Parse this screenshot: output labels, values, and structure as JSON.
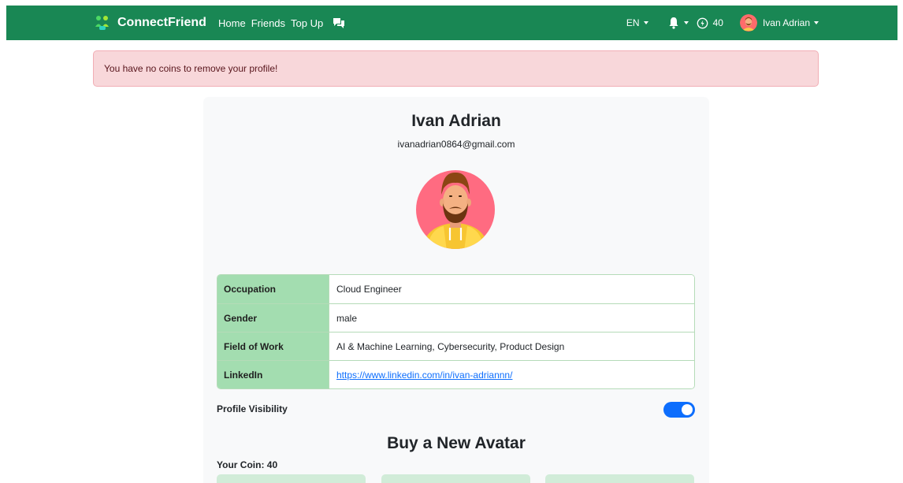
{
  "navbar": {
    "brand": "ConnectFriend",
    "links": [
      "Home",
      "Friends",
      "Top Up"
    ],
    "chat_icon": "chat-bubbles-icon",
    "language": "EN",
    "notification_icon": "bell-icon",
    "coin_icon": "coin-icon",
    "coins": "40",
    "user_name": "Ivan Adrian"
  },
  "alert": {
    "message": "You have no coins to remove your profile!"
  },
  "profile": {
    "name": "Ivan Adrian",
    "email": "ivanadrian0864@gmail.com",
    "avatar_icon": "bearded-man-avatar-icon",
    "details": [
      {
        "label": "Occupation",
        "value": "Cloud Engineer"
      },
      {
        "label": "Gender",
        "value": "male"
      },
      {
        "label": "Field of Work",
        "value": "AI & Machine Learning, Cybersecurity, Product Design"
      },
      {
        "label": "LinkedIn",
        "value": "https://www.linkedin.com/in/ivan-adriannn/"
      }
    ],
    "visibility_label": "Profile Visibility",
    "visibility_on": true
  },
  "shop": {
    "title": "Buy a New Avatar",
    "coin_text": "Your Coin: 40"
  },
  "colors": {
    "navbar": "#198754",
    "alert_bg": "#f8d7da",
    "table_label_bg": "#a3ddb0",
    "toggle": "#0d6efd"
  }
}
